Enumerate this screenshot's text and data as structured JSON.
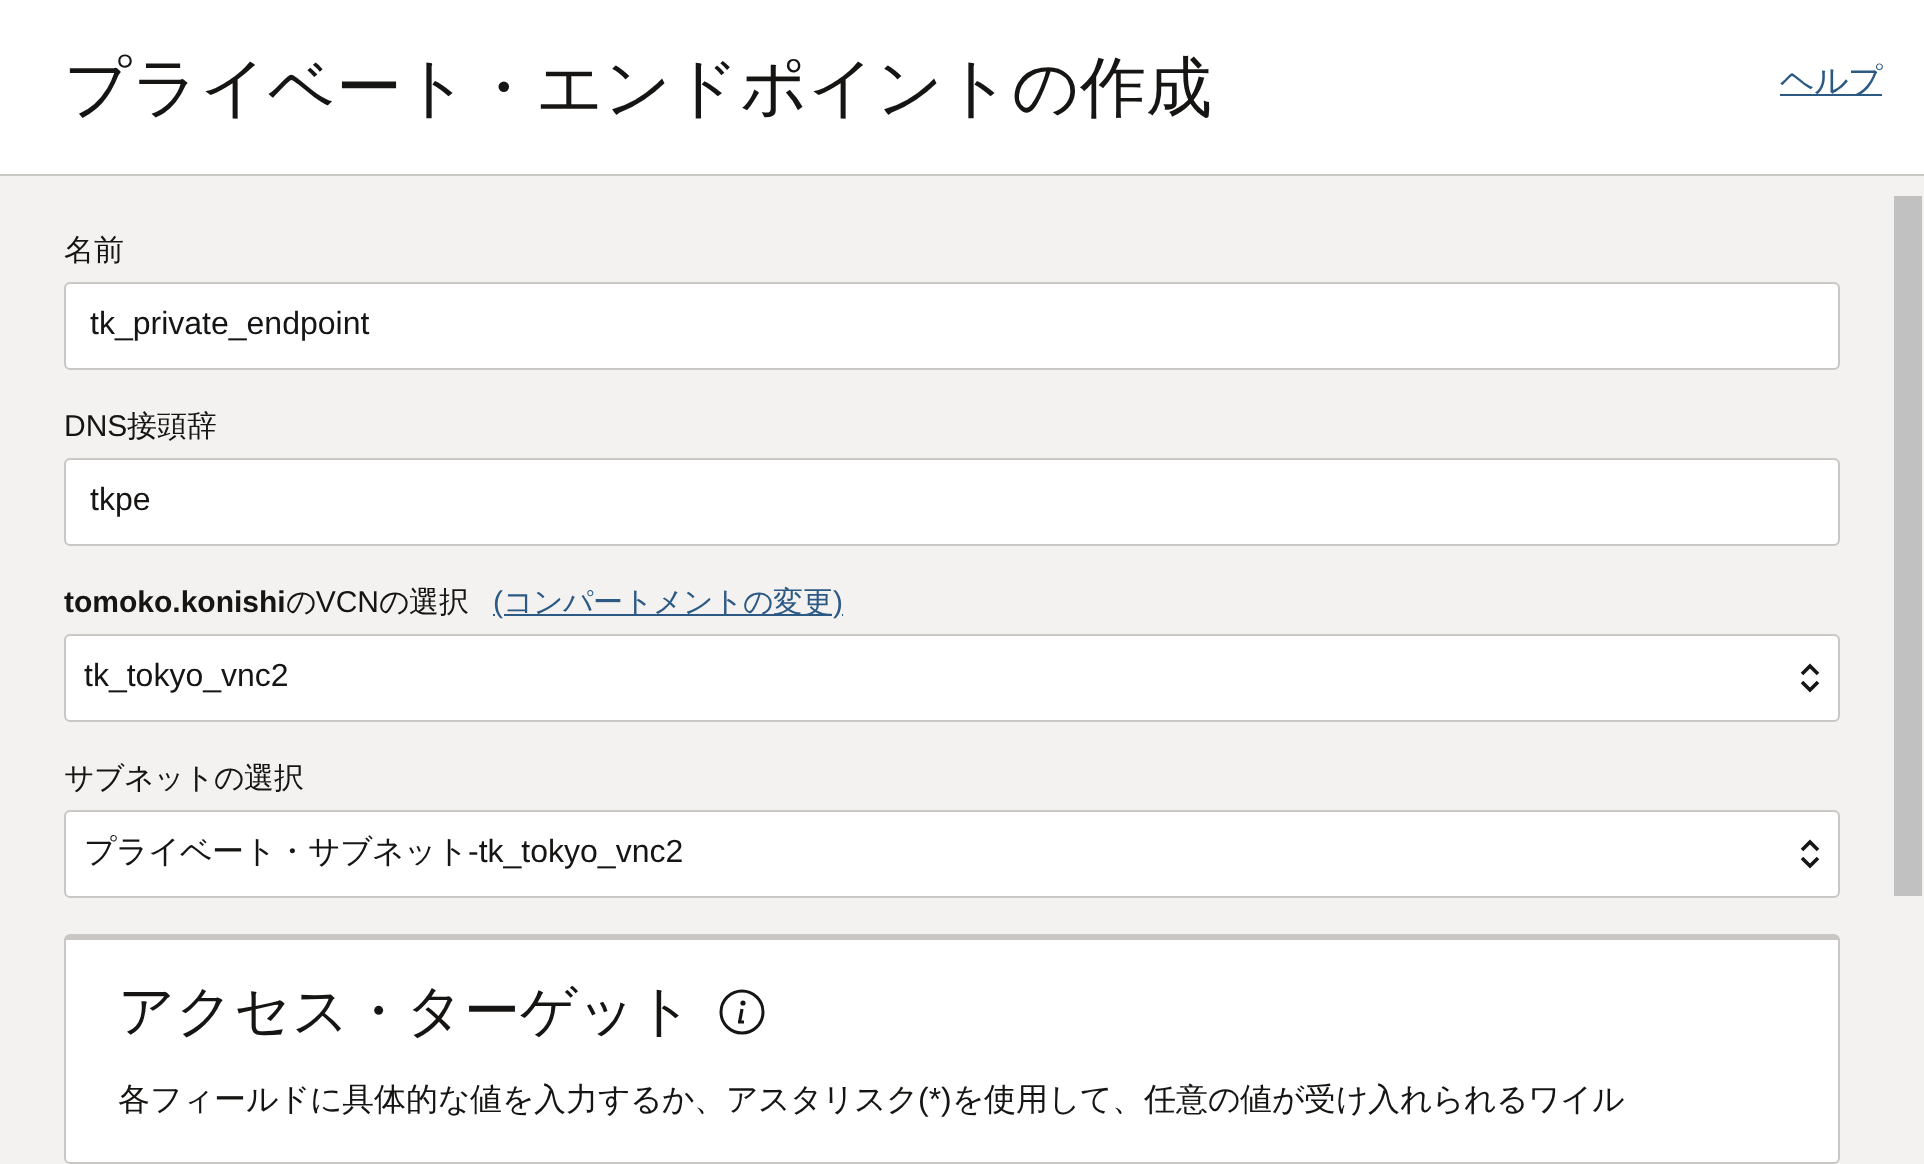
{
  "header": {
    "title": "プライベート・エンドポイントの作成",
    "help_link": "ヘルプ"
  },
  "fields": [
    {
      "kind": "text",
      "label": "名前",
      "value": "tk_private_endpoint"
    },
    {
      "kind": "text",
      "label": "DNS接頭辞",
      "value": "tkpe"
    },
    {
      "kind": "select",
      "label": "**tomoko.konishi**のVCNの選択",
      "link": "(コンパートメントの変更)",
      "value": "tk_tokyo_vnc2"
    },
    {
      "kind": "select",
      "label": "サブネットの選択",
      "value": "プライベート・サブネット-tk_tokyo_vnc2"
    }
  ],
  "access_target": {
    "title": "アクセス・ターゲット",
    "description": "各フィールドに具体的な値を入力するか、アスタリスク(*)を使用して、任意の値が受け入れられるワイル"
  }
}
